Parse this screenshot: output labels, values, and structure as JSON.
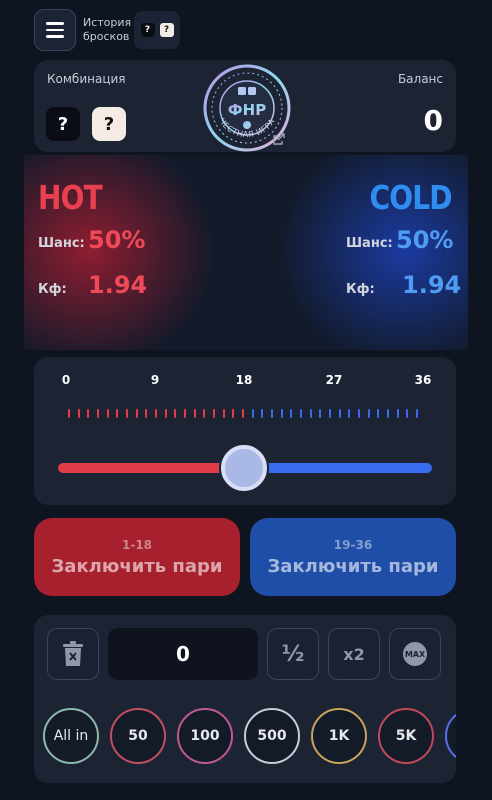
{
  "header": {
    "history_label": "История бросков",
    "history_dice": [
      "?",
      "?"
    ]
  },
  "info": {
    "combination_label": "Комбинация",
    "combination_dice": [
      "?",
      "?"
    ],
    "balance_label": "Баланс",
    "balance_value": "0",
    "seal_abbr": "ФНР",
    "seal_text": "ЧЕСТНАЯ ИГРА"
  },
  "hot": {
    "title": "HOT",
    "chance_label": "Шанс:",
    "chance_value": "50%",
    "coef_label": "Кф:",
    "coef_value": "1.94"
  },
  "cold": {
    "title": "COLD",
    "chance_label": "Шанс:",
    "chance_value": "50%",
    "coef_label": "Кф:",
    "coef_value": "1.94"
  },
  "slider": {
    "scale": [
      "0",
      "9",
      "18",
      "27",
      "36"
    ],
    "value": 18,
    "min": 0,
    "max": 36,
    "colors": {
      "low": "#e03c48",
      "high": "#3a6cf0"
    }
  },
  "bets": {
    "hot": {
      "range": "1-18",
      "label": "Заключить пари"
    },
    "cold": {
      "range": "19-36",
      "label": "Заключить пари"
    }
  },
  "amount": {
    "value": "0",
    "half_label": "½",
    "double_label": "x2",
    "max_label": "MAX",
    "chips": [
      {
        "label": "All in",
        "color": "#8fb8a8"
      },
      {
        "label": "50",
        "color": "#c0505f"
      },
      {
        "label": "100",
        "color": "#c05a8a"
      },
      {
        "label": "500",
        "color": "#c8ccd6"
      },
      {
        "label": "1K",
        "color": "#c9a35a"
      },
      {
        "label": "5K",
        "color": "#c04a5a"
      }
    ]
  },
  "icons": [
    "menu-icon",
    "trash-icon",
    "external-link-icon"
  ]
}
